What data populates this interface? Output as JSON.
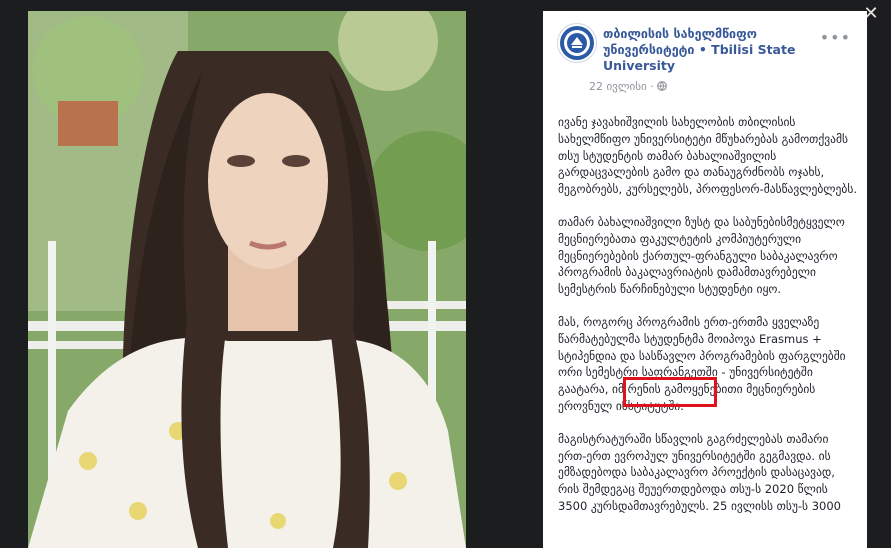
{
  "page": {
    "name": "თბილისის სახელმწიფო უნივერსიტეტი",
    "separator": "•",
    "name_en": "Tbilisi State University",
    "date": "22 ივლისი",
    "meta_sep": "·"
  },
  "post": {
    "paragraphs": [
      "ივანე ჯავახიშვილის სახელობის თბილისის სახელმწიფო უნივერსიტეტი მწუხარებას გამოთქვამს თსუ სტუდენტის თამარ ბახალიაშვილის გარდაცვალების გამო და თანაუგრძნობს ოჯახს, მეგობრებს, კურსელებს, პროფესორ-მასწავლებლებს.",
      "თამარ ბახალიაშვილი ზუსტ და საბუნებისმეტყველო მეცნიერებათა ფაკულტეტის კომპიუტერული მეცნიერებების ქართულ-ფრანგული საბაკალავრო პროგრამის ბაკალავრიატის დამამთავრებელი სემესტრის წარჩინებული სტუდენტი იყო.",
      "მას, როგორც პროგრამის ერთ-ერთმა ყველაზე წარმატებულმა სტუდენტმა მოიპოვა Erasmus + სტიპენდია და სასწავლო პროგრამების ფარგლებში ორი სემესტრი საფრანგეთში - უნივერსიტეტში გაატარა, იმ რენის გამოყენებითი მეცნიერების ეროვნულ ინსტიტუტში.",
      "მაგისტრატურაში სწავლის გაგრძელებას თამარი ერთ-ერთ ევროპულ უნივერსიტეტში გეგმავდა. ის ემზადებოდა საბაკალავრო პროექტის დასაცავად, რის შემდეგაც შეუერთდებოდა თსუ-ს 2020 წლის 3500 კურსდამთავრებულს. 25 ივლისს თსუ-ს 3000"
    ]
  },
  "icons": {
    "close": "close-icon",
    "more": "more-icon",
    "globe": "globe-icon"
  },
  "accent_color": "#385898",
  "highlight_color": "#e0121b"
}
